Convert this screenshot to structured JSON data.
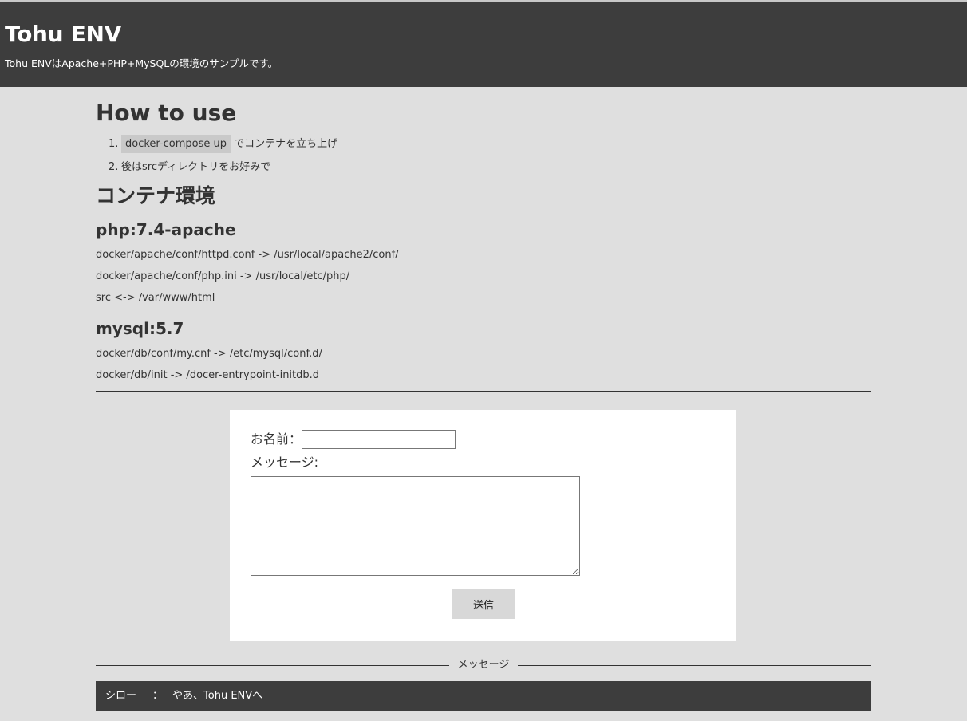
{
  "header": {
    "title": "Tohu ENV",
    "subtitle": "Tohu ENVはApache+PHP+MySQLの環境のサンプルです。"
  },
  "howto": {
    "title": "How to use",
    "steps": [
      {
        "num": "1.",
        "code": "docker-compose up",
        "text": "でコンテナを立ち上げ"
      },
      {
        "num": "2.",
        "text": "後はsrcディレクトリをお好みで"
      }
    ]
  },
  "env": {
    "title": "コンテナ環境",
    "php": {
      "title": "php:7.4-apache",
      "paths": [
        "docker/apache/conf/httpd.conf -> /usr/local/apache2/conf/",
        "docker/apache/conf/php.ini -> /usr/local/etc/php/",
        "src <-> /var/www/html"
      ]
    },
    "mysql": {
      "title": "mysql:5.7",
      "paths": [
        "docker/db/conf/my.cnf -> /etc/mysql/conf.d/",
        "docker/db/init -> /docer-entrypoint-initdb.d"
      ]
    }
  },
  "form": {
    "name_label": "お名前：",
    "name_value": "",
    "message_label": "メッセージ:",
    "message_value": "",
    "submit_label": "送信"
  },
  "messages": {
    "divider_label": "メッセージ",
    "items": [
      {
        "author": "シロー",
        "separator": "：",
        "text": "やあ、Tohu ENVへ"
      }
    ]
  }
}
